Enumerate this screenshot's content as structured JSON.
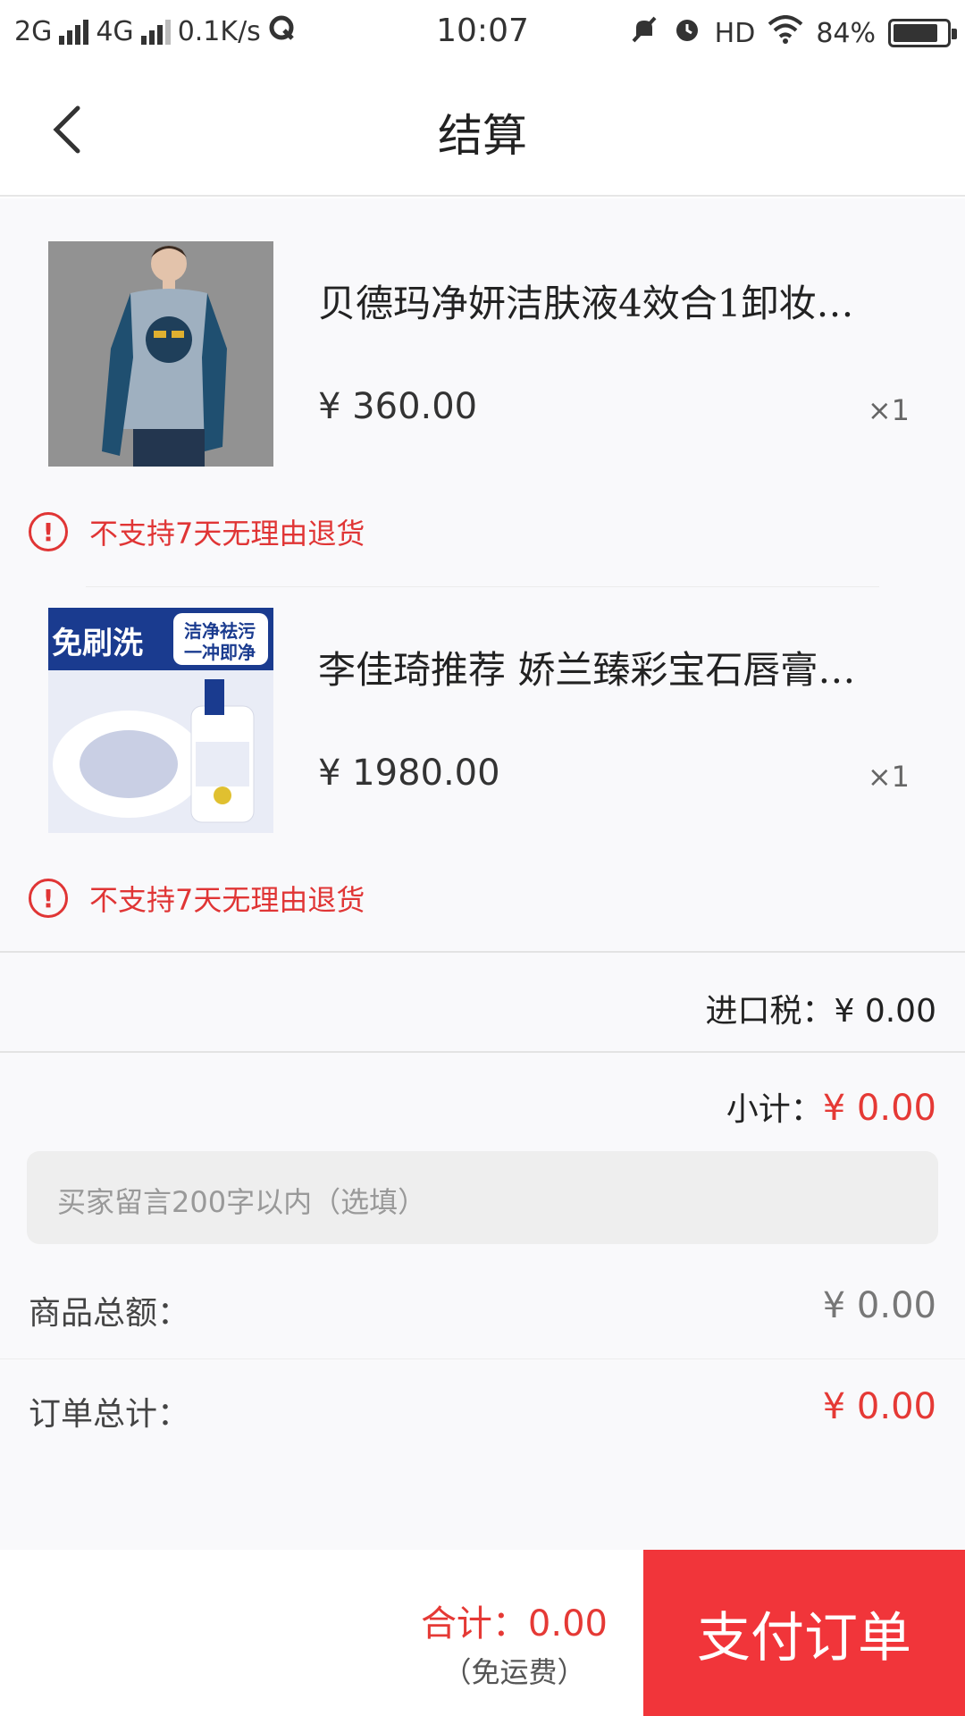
{
  "status_bar": {
    "network_1": "2G",
    "network_2": "4G",
    "speed": "0.1K/s",
    "time": "10:07",
    "hd": "HD",
    "battery_text": "84%",
    "battery_level": 0.84
  },
  "header": {
    "title": "结算"
  },
  "products": [
    {
      "name": "贝德玛净妍洁肤液4效合1卸妆…",
      "price": "¥ 360.00",
      "qty": "×1",
      "warning": "不支持7天无理由退货"
    },
    {
      "name": "李佳琦推荐 娇兰臻彩宝石唇膏…",
      "price": "¥ 1980.00",
      "qty": "×1",
      "warning": "不支持7天无理由退货",
      "image_text_1": "免刷洗",
      "image_text_2": "洁净祛污",
      "image_text_3": "一冲即净"
    }
  ],
  "summary": {
    "tax_label": "进口税：",
    "tax_value": "¥ 0.00",
    "subtotal_label": "小计：",
    "subtotal_value": "¥ 0.00",
    "message_placeholder": "买家留言200字以内（选填）",
    "goods_total_label": "商品总额：",
    "goods_total_value": "¥ 0.00",
    "order_total_label": "订单总计：",
    "order_total_value": "¥ 0.00"
  },
  "bottom": {
    "total_text": "合计：0.00",
    "shipping_text": "（免运费）",
    "pay_button": "支付订单"
  },
  "colors": {
    "accent_red": "#e53935",
    "pay_button": "#f1353a"
  }
}
